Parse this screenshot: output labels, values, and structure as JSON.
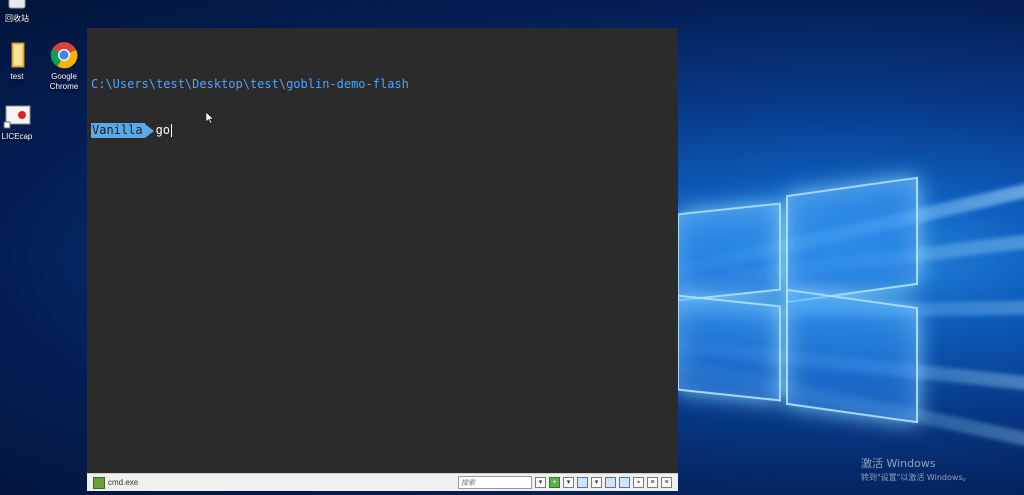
{
  "desktop": {
    "icons": [
      {
        "label": "回收站",
        "icon": "recycle-bin-icon"
      },
      {
        "label": "test",
        "icon": "folder-icon"
      },
      {
        "label": "Google\nChrome",
        "label_line1": "Google",
        "label_line2": "Chrome",
        "icon": "chrome-icon"
      },
      {
        "label": "LICEcap",
        "icon": "licecap-icon"
      }
    ]
  },
  "console": {
    "path": "C:\\Users\\test\\Desktop\\test\\goblin-demo-flash",
    "prompt_segment": "Vanilla",
    "typed": "go"
  },
  "statusbar": {
    "process": "cmd.exe",
    "search_placeholder": "搜索"
  },
  "watermark": {
    "title": "激活 Windows",
    "subtitle": "转到\"设置\"以激活 Windows。"
  },
  "colors": {
    "console_bg": "#2b2b2b",
    "path_text": "#4da3ff",
    "prompt_bg": "#5aa9ea"
  }
}
